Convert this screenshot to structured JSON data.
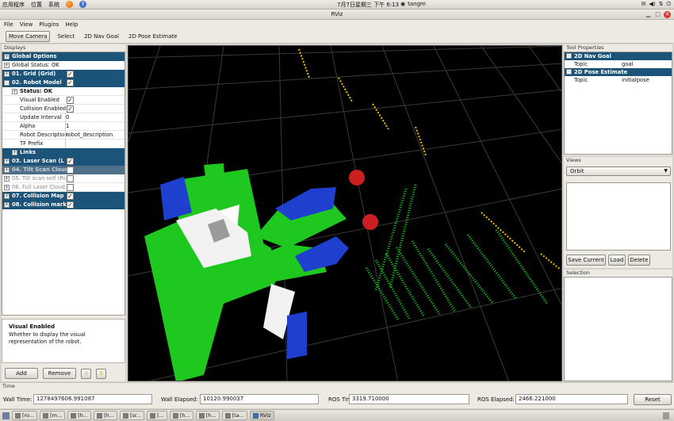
{
  "top_panel": {
    "menus": [
      "应用程序",
      "位置",
      "系统"
    ],
    "clock": "7月7日星期三 下午 6:13",
    "user": "tangm"
  },
  "window": {
    "title": "RViz"
  },
  "menubar": [
    "File",
    "View",
    "Plugins",
    "Help"
  ],
  "toolbar": [
    "Move Camera",
    "Select",
    "2D Nav Goal",
    "2D Pose Estimate"
  ],
  "displays": {
    "header": "Displays",
    "rows": [
      {
        "label": "Global Options",
        "style": "hl",
        "exp": "+",
        "indent": 0
      },
      {
        "label": "Global Status: OK",
        "style": "plain",
        "exp": "+",
        "indent": 0
      },
      {
        "label": "01. Grid (Grid)",
        "style": "hl",
        "exp": "+",
        "indent": 0,
        "checked": true
      },
      {
        "label": "02. Robot Model",
        "style": "hl",
        "exp": "-",
        "indent": 0,
        "checked": true
      },
      {
        "label": "Status: OK",
        "style": "bold",
        "exp": "+",
        "indent": 1
      },
      {
        "label": "Visual Enabled",
        "style": "sub",
        "indent": 2,
        "checked": true
      },
      {
        "label": "Collision Enabled",
        "style": "sub",
        "indent": 2,
        "checked": true
      },
      {
        "label": "Update Interval",
        "style": "sub",
        "indent": 2,
        "value": "0"
      },
      {
        "label": "Alpha",
        "style": "sub",
        "indent": 2,
        "value": "1"
      },
      {
        "label": "Robot Description",
        "style": "sub",
        "indent": 2,
        "value": "robot_description"
      },
      {
        "label": "TF Prefix",
        "style": "sub",
        "indent": 2,
        "value": ""
      },
      {
        "label": "Links",
        "style": "hl",
        "exp": "+",
        "indent": 1
      },
      {
        "label": "03. Laser Scan (L",
        "style": "hl",
        "exp": "+",
        "indent": 0,
        "checked": true
      },
      {
        "label": "04. Tilt Scan Cloud (",
        "style": "dimhl",
        "exp": "+",
        "indent": 0,
        "checked": false
      },
      {
        "label": "05. Tilt scan self (Po",
        "style": "dim",
        "exp": "+",
        "indent": 0,
        "checked": false
      },
      {
        "label": "06. Full Laser Cloud",
        "style": "dim",
        "exp": "+",
        "indent": 0,
        "checked": false
      },
      {
        "label": "07. Collision Map",
        "style": "hl",
        "exp": "+",
        "indent": 0,
        "checked": true
      },
      {
        "label": "08. Collision mark",
        "style": "hl",
        "exp": "+",
        "indent": 0,
        "checked": true
      }
    ],
    "help_title": "Visual Enabled",
    "help_text": "Whether to display the visual representation of the robot.",
    "add_label": "Add",
    "remove_label": "Remove"
  },
  "tool_properties": {
    "header": "Tool Properties",
    "rows": [
      {
        "label": "2D Nav Goal",
        "style": "hl"
      },
      {
        "label": "Topic",
        "value": "goal"
      },
      {
        "label": "2D Pose Estimate",
        "style": "hl"
      },
      {
        "label": "Topic",
        "value": "initialpose"
      }
    ]
  },
  "views": {
    "header": "Views",
    "selected": "Orbit",
    "save_label": "Save Current",
    "load_label": "Load",
    "delete_label": "Delete"
  },
  "selection": {
    "header": "Selection"
  },
  "time": {
    "header": "Time",
    "wall_time_label": "Wall Time:",
    "wall_time": "1278497606.991087",
    "wall_elapsed_label": "Wall Elapsed:",
    "wall_elapsed": "10120.990037",
    "ros_time_label": "ROS Time:",
    "ros_time": "3319.710000",
    "ros_elapsed_label": "ROS Elapsed:",
    "ros_elapsed": "2466.221000",
    "reset_label": "Reset"
  },
  "taskbar": [
    "[ro...",
    "[m...",
    "[h...",
    "[h...",
    "[sr...",
    "[...",
    "[h...",
    "[h...",
    "[ta...",
    "RViz"
  ],
  "colors": {
    "highlight": "#1c5479",
    "grid": "#3a3a3a",
    "laser": "#f5c000",
    "collision": "#18d018"
  }
}
